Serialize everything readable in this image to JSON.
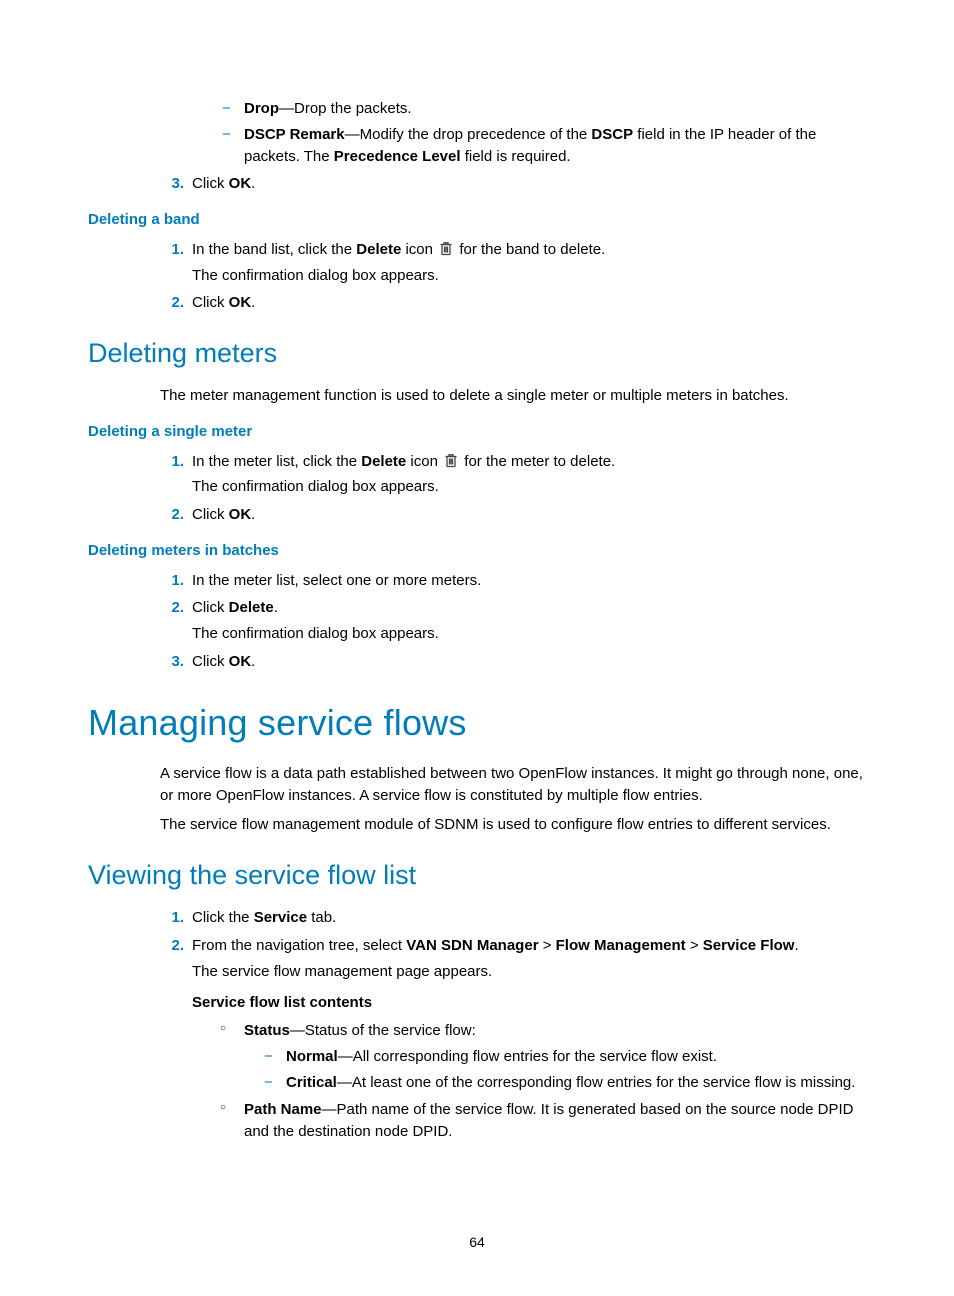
{
  "pageNumber": "64",
  "top": {
    "dash1": {
      "bold": "Drop",
      "text": "—Drop the packets."
    },
    "dash2": {
      "bold1": "DSCP Remark",
      "mid1": "—Modify the drop precedence of the ",
      "bold2": "DSCP",
      "mid2": " field in the IP header of the packets. The ",
      "bold3": "Precedence Level",
      "mid3": " field is required."
    },
    "step3": {
      "num": "3.",
      "pre": "Click ",
      "bold": "OK",
      "post": "."
    }
  },
  "delBand": {
    "title": "Deleting a band",
    "step1": {
      "num": "1.",
      "pre": "In the band list, click the ",
      "bold": "Delete",
      "post1": " icon ",
      "post2": " for the band to delete."
    },
    "confirm": "The confirmation dialog box appears.",
    "step2": {
      "num": "2.",
      "pre": "Click ",
      "bold": "OK",
      "post": "."
    }
  },
  "delMeters": {
    "title": "Deleting meters",
    "intro": "The meter management function is used to delete a single meter or multiple meters in batches."
  },
  "delSingleMeter": {
    "title": "Deleting a single meter",
    "step1": {
      "num": "1.",
      "pre": "In the meter list, click the ",
      "bold": "Delete",
      "post1": " icon ",
      "post2": " for the meter to delete."
    },
    "confirm": "The confirmation dialog box appears.",
    "step2": {
      "num": "2.",
      "pre": "Click ",
      "bold": "OK",
      "post": "."
    }
  },
  "delBatch": {
    "title": "Deleting meters in batches",
    "step1": {
      "num": "1.",
      "text": "In the meter list, select one or more meters."
    },
    "step2": {
      "num": "2.",
      "pre": "Click ",
      "bold": "Delete",
      "post": "."
    },
    "confirm": "The confirmation dialog box appears.",
    "step3": {
      "num": "3.",
      "pre": "Click ",
      "bold": "OK",
      "post": "."
    }
  },
  "manage": {
    "title": "Managing service flows",
    "p1": "A service flow is a data path established between two OpenFlow instances. It might go through none, one, or more OpenFlow instances. A service flow is constituted by multiple flow entries.",
    "p2": "The service flow management module of SDNM is used to configure flow entries to different services."
  },
  "viewList": {
    "title": "Viewing the service flow list",
    "step1": {
      "num": "1.",
      "pre": "Click the ",
      "bold": "Service",
      "post": " tab."
    },
    "step2": {
      "num": "2.",
      "pre": "From the navigation tree, select ",
      "b1": "VAN SDN Manager",
      "sep1": " > ",
      "b2": "Flow Management",
      "sep2": " > ",
      "b3": "Service Flow",
      "post": "."
    },
    "appears": "The service flow management page appears.",
    "contentsTitle": "Service flow list contents",
    "status": {
      "bold": "Status",
      "text": "—Status of the service flow:"
    },
    "normal": {
      "bold": "Normal",
      "text": "—All corresponding flow entries for the service flow exist."
    },
    "critical": {
      "bold": "Critical",
      "text": "—At least one of the corresponding flow entries for the service flow is missing."
    },
    "pathName": {
      "bold": "Path Name",
      "text": "—Path name of the service flow. It is generated based on the source node DPID and the destination node DPID."
    }
  }
}
